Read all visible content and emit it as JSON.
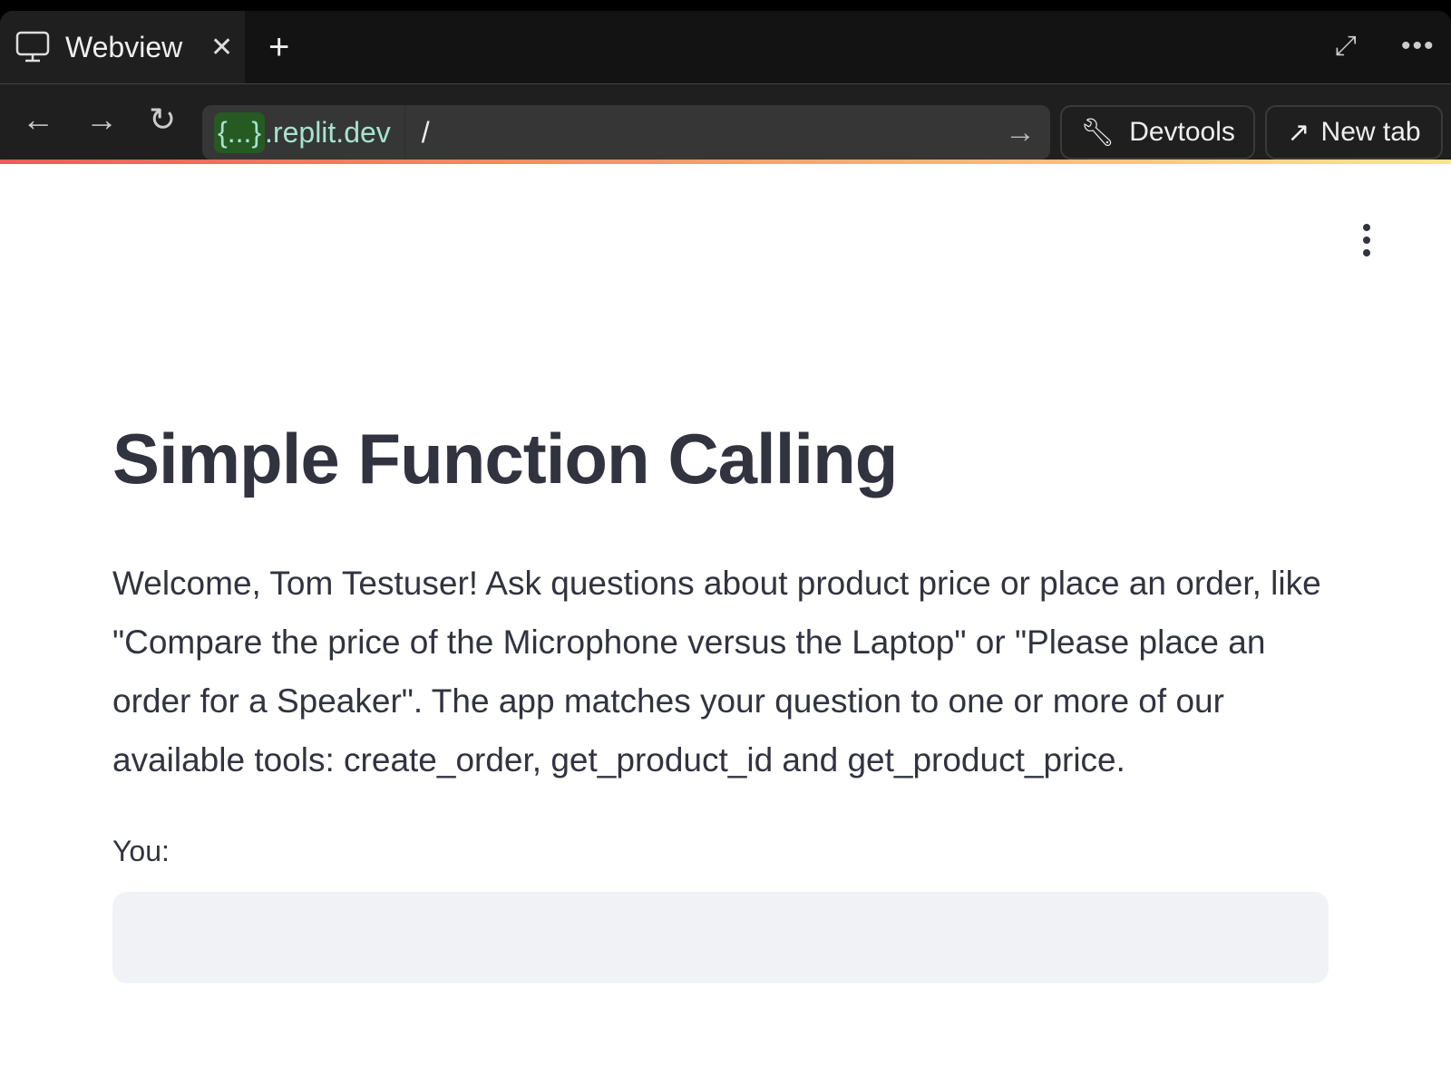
{
  "browser": {
    "tab_title": "Webview",
    "url_host_badge": "{...}",
    "url_host": ".replit.dev",
    "url_path": "/",
    "devtools_label": "Devtools",
    "new_tab_label": "New tab"
  },
  "app": {
    "title": "Simple Function Calling",
    "description": "Welcome, Tom Testuser! Ask questions about product price or place an order, like \"Compare the price of the Microphone versus the Laptop\" or \"Please place an order for a Speaker\". The app matches your question to one or more of our available tools: create_order, get_product_id and get_product_price.",
    "input_label": "You:",
    "input_value": ""
  },
  "colors": {
    "gradient": [
      "#ef5a5a",
      "#f59f6a",
      "#fde68a"
    ],
    "url_badge": "#265a22",
    "input_bg": "#f0f2f6"
  }
}
